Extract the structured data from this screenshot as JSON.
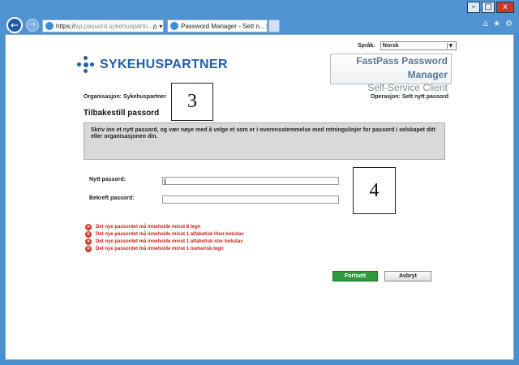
{
  "browser": {
    "back_icon": "←",
    "forward_icon": "→",
    "address_scheme": "https://",
    "address_host": "sp.passord.sykehuspartn...",
    "address_tools": "ρ ▾ 🔒 ↻",
    "tab_title": "Password Manager - Sett n...",
    "tab_close": "×",
    "window_minimize": "–",
    "window_maximize": "□",
    "window_close": "x",
    "toolbar_icons": [
      "⌂",
      "★",
      "⚙"
    ]
  },
  "page": {
    "language_label": "Språk:",
    "language_value": "Norsk",
    "language_arrow": "▼",
    "logo_text": "SYKEHUSPARTNER",
    "product_title": "FastPass Password Manager",
    "product_subtitle": "Self-Service Client",
    "organisation": "Organisasjon: Sykehuspartner",
    "operation": "Operasjon: Sett nytt passord",
    "heading": "Tilbakestill passord",
    "instructions": "Skriv inn et nytt passord, og vær nøye med å velge et som er i overensstemmelse med retningslinjer for passord i selskapet ditt eller organisasjonen din.",
    "new_password_label": "Nytt passord:",
    "new_password_value": "",
    "confirm_password_label": "Bekreft passord:",
    "confirm_password_value": "",
    "errors": [
      "Det nye passordet må inneholde minst 8 tegn",
      "Det nye passordet må inneholde minst 1 alfabetisk liten bokstav",
      "Det nye passordet må inneholde minst 1 alfabetisk stor bokstav",
      "Det nye passordet må inneholde minst 1 numerisk tegn"
    ],
    "error_icon": "×",
    "continue_button": "Fortsett",
    "cancel_button": "Avbryt"
  },
  "callouts": [
    "3",
    "4"
  ],
  "colors": {
    "brand_blue": "#1f5fae",
    "continue_green": "#2f9a3c",
    "error_red": "#d0201a"
  }
}
